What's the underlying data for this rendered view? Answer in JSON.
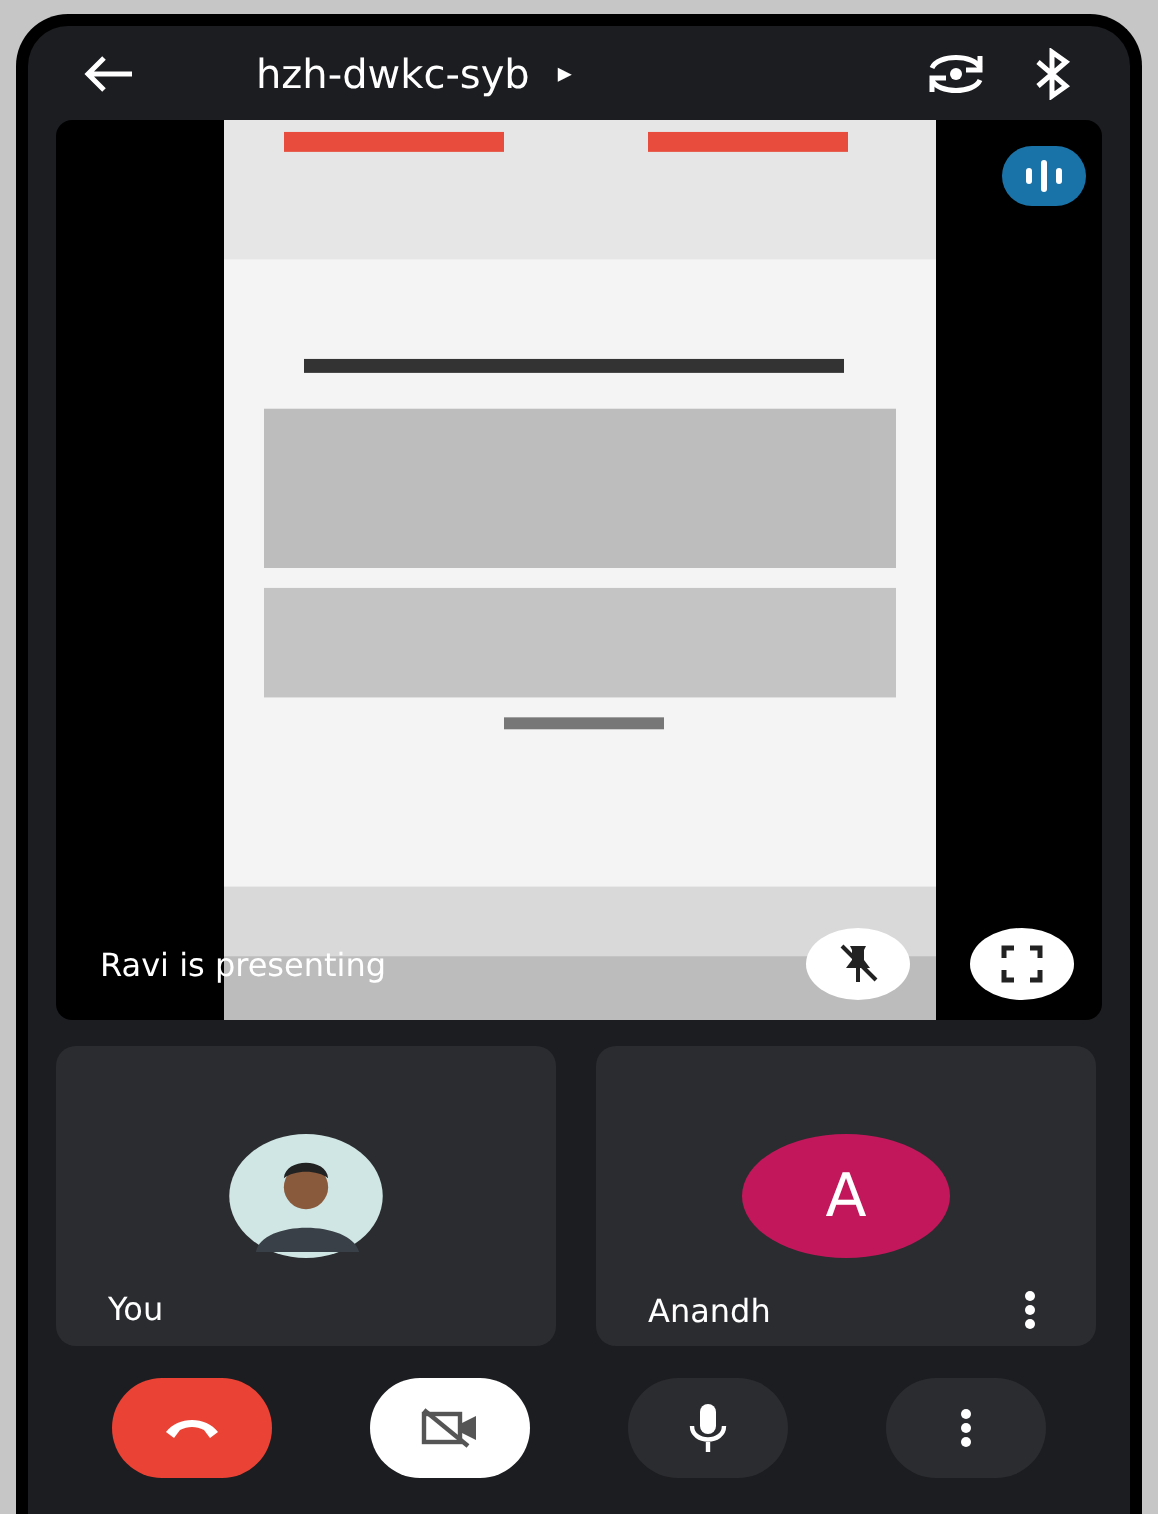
{
  "meeting": {
    "code": "hzh-dwkc-syb",
    "arrow": "▸"
  },
  "presentation": {
    "kind": "picture",
    "caption": "Ravi is presenting"
  },
  "participants": [
    {
      "name": "You",
      "menu": false
    },
    {
      "name": "Anandh",
      "kind": "initial",
      "initial": "A",
      "color": "#c2185b",
      "menu": true
    }
  ],
  "controls": {
    "camera_on": false,
    "mic_on": true
  }
}
